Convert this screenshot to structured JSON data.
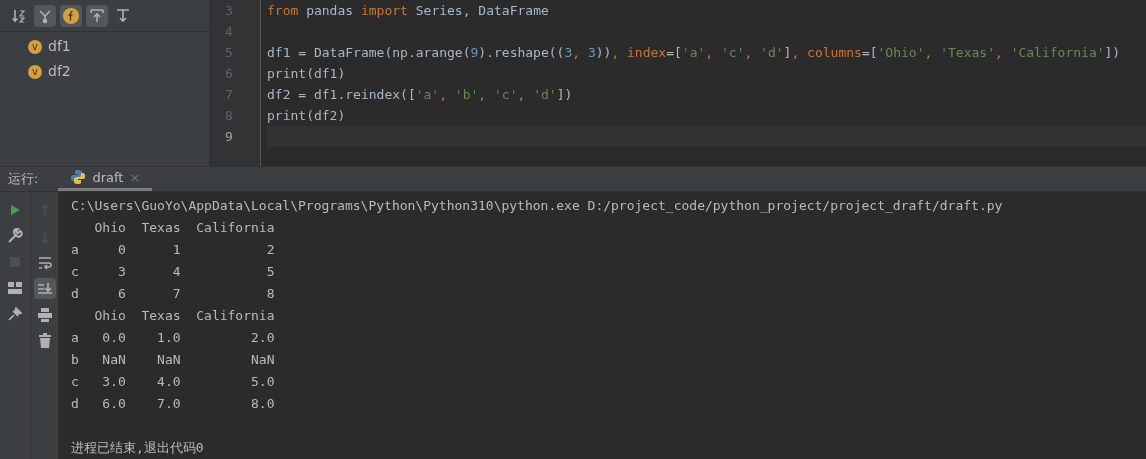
{
  "structure": {
    "variables": [
      {
        "name": "df1",
        "badge": "v"
      },
      {
        "name": "df2",
        "badge": "v"
      }
    ],
    "toolbar": [
      {
        "kind": "sort",
        "selected": false
      },
      {
        "kind": "fields",
        "selected": true
      },
      {
        "kind": "functions",
        "selected": true
      },
      {
        "kind": "expand",
        "selected": true
      },
      {
        "kind": "collapse",
        "selected": false
      }
    ]
  },
  "editor": {
    "lines": [
      {
        "number": "3",
        "current": false,
        "tokens": [
          {
            "kind": "keyword",
            "text": "from"
          },
          {
            "kind": "plain",
            "text": " pandas "
          },
          {
            "kind": "keyword",
            "text": "import"
          },
          {
            "kind": "plain",
            "text": " Series, DataFrame"
          }
        ]
      },
      {
        "number": "4",
        "current": false
      },
      {
        "number": "5",
        "current": false,
        "tokens": [
          {
            "kind": "plain",
            "text": "df1 = DataFrame(np.arange("
          },
          {
            "kind": "number",
            "text": "9"
          },
          {
            "kind": "plain",
            "text": ").reshape(("
          },
          {
            "kind": "number",
            "text": "3"
          },
          {
            "kind": "keyword",
            "text": ", "
          },
          {
            "kind": "number",
            "text": "3"
          },
          {
            "kind": "plain",
            "text": "))"
          },
          {
            "kind": "keyword",
            "text": ", "
          },
          {
            "kind": "param",
            "text": "index"
          },
          {
            "kind": "plain",
            "text": "=["
          },
          {
            "kind": "string",
            "text": "'a'"
          },
          {
            "kind": "keyword",
            "text": ", "
          },
          {
            "kind": "string",
            "text": "'c'"
          },
          {
            "kind": "keyword",
            "text": ", "
          },
          {
            "kind": "string",
            "text": "'d'"
          },
          {
            "kind": "plain",
            "text": "]"
          },
          {
            "kind": "keyword",
            "text": ", "
          },
          {
            "kind": "param",
            "text": "columns"
          },
          {
            "kind": "plain",
            "text": "=["
          },
          {
            "kind": "string",
            "text": "'Ohio'"
          },
          {
            "kind": "keyword",
            "text": ", "
          },
          {
            "kind": "string",
            "text": "'Texas'"
          },
          {
            "kind": "keyword",
            "text": ", "
          },
          {
            "kind": "string",
            "text": "'California'"
          },
          {
            "kind": "plain",
            "text": "])"
          }
        ]
      },
      {
        "number": "6",
        "current": false,
        "tokens": [
          {
            "kind": "builtin",
            "text": "print"
          },
          {
            "kind": "plain",
            "text": "(df1)"
          }
        ]
      },
      {
        "number": "7",
        "current": false,
        "tokens": [
          {
            "kind": "plain",
            "text": "df2 = df1.reindex(["
          },
          {
            "kind": "string",
            "text": "'a'"
          },
          {
            "kind": "keyword",
            "text": ", "
          },
          {
            "kind": "string",
            "text": "'b'"
          },
          {
            "kind": "keyword",
            "text": ", "
          },
          {
            "kind": "string",
            "text": "'c'"
          },
          {
            "kind": "keyword",
            "text": ", "
          },
          {
            "kind": "string",
            "text": "'d'"
          },
          {
            "kind": "plain",
            "text": "])"
          }
        ]
      },
      {
        "number": "8",
        "current": false,
        "tokens": [
          {
            "kind": "builtin",
            "text": "print"
          },
          {
            "kind": "plain",
            "text": "(df2)"
          }
        ]
      },
      {
        "number": "9",
        "current": true
      }
    ]
  },
  "run": {
    "label": "运行:",
    "tab": {
      "title": "draft",
      "selected": true,
      "close": "×"
    },
    "tools_left": [
      {
        "kind": "run",
        "disabled": false
      },
      {
        "kind": "wrench",
        "disabled": false
      },
      {
        "kind": "stop",
        "disabled": true
      },
      {
        "kind": "layout",
        "disabled": false
      },
      {
        "kind": "pin",
        "disabled": false
      }
    ],
    "tools_right": [
      {
        "kind": "up",
        "disabled": true,
        "selected": false
      },
      {
        "kind": "down",
        "disabled": true,
        "selected": false
      },
      {
        "kind": "wrap",
        "disabled": false,
        "selected": false
      },
      {
        "kind": "scroll-end",
        "disabled": false,
        "selected": true
      },
      {
        "kind": "print",
        "disabled": false,
        "selected": false
      },
      {
        "kind": "trash",
        "disabled": false,
        "selected": false
      }
    ],
    "output": [
      "C:\\Users\\GuoYo\\AppData\\Local\\Programs\\Python\\Python310\\python.exe D:/project_code/python_project/project_draft/draft.py",
      "   Ohio  Texas  California",
      "a     0      1           2",
      "c     3      4           5",
      "d     6      7           8",
      "   Ohio  Texas  California",
      "a   0.0    1.0         2.0",
      "b   NaN    NaN         NaN",
      "c   3.0    4.0         5.0",
      "d   6.0    7.0         8.0"
    ],
    "exit_message": "进程已结束,退出代码0"
  }
}
